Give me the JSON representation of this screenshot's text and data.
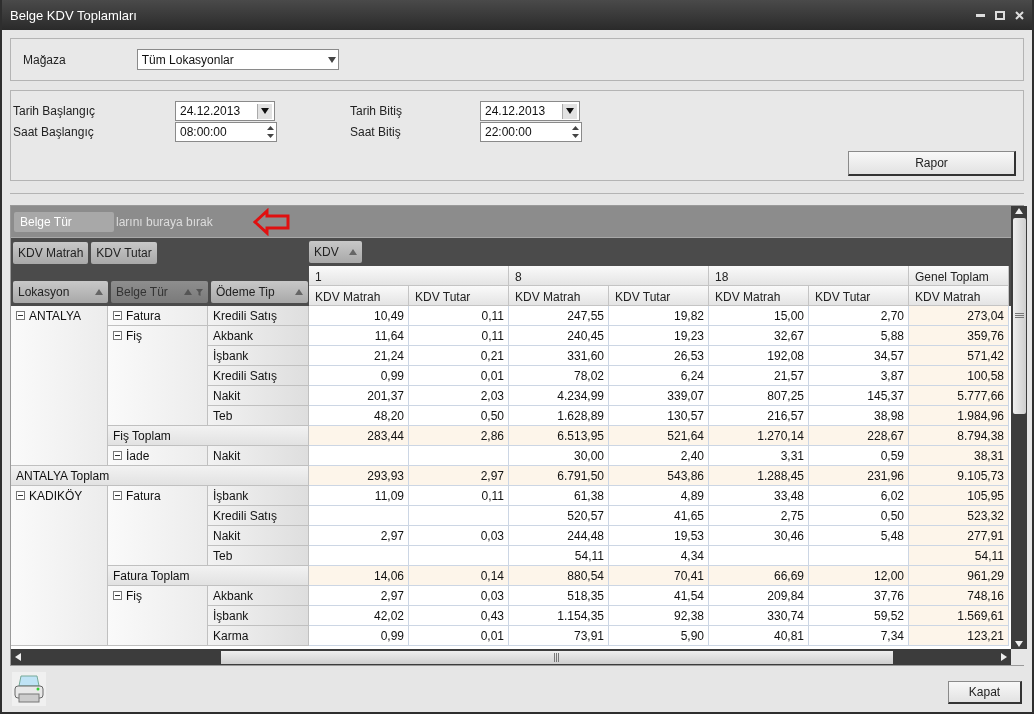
{
  "window": {
    "title": "Belge KDV Toplamları"
  },
  "store_filter": {
    "label": "Mağaza",
    "value": "Tüm Lokasyonlar"
  },
  "period": {
    "start": [
      {
        "label": "Tarih Başlangıç",
        "value": "24.12.2013",
        "kind": "date"
      },
      {
        "label": "Saat Başlangıç",
        "value": "08:00:00",
        "kind": "time"
      }
    ],
    "end": [
      {
        "label": "Tarih Bitiş",
        "value": "24.12.2013",
        "kind": "date"
      },
      {
        "label": "Saat Bitiş",
        "value": "22:00:00",
        "kind": "time"
      }
    ]
  },
  "report_button": "Rapor",
  "pivot": {
    "filter_area": {
      "dragged_field": "Belge Tür",
      "hint": "larını buraya bırak"
    },
    "data_fields": [
      "KDV Matrah",
      "KDV Tutar"
    ],
    "column_fields": [
      {
        "label": "KDV",
        "filtered": false
      }
    ],
    "row_fields": [
      {
        "label": "Lokasyon",
        "filtered": false
      },
      {
        "label": "Belge Tür",
        "filtered": true
      },
      {
        "label": "Ödeme Tip",
        "filtered": false
      }
    ],
    "column_groups": [
      {
        "label": "1",
        "measures": [
          "KDV Matrah",
          "KDV Tutar"
        ]
      },
      {
        "label": "8",
        "measures": [
          "KDV Matrah",
          "KDV Tutar"
        ]
      },
      {
        "label": "18",
        "measures": [
          "KDV Matrah",
          "KDV Tutar"
        ]
      },
      {
        "label": "Genel Toplam",
        "measures": [
          "KDV Matrah"
        ]
      }
    ],
    "locations": [
      {
        "name": "ANTALYA",
        "expanded": true,
        "doc_types": [
          {
            "name": "Fatura",
            "expanded": true,
            "payments": [
              {
                "name": "Kredili Satış",
                "values": [
                  "10,49",
                  "0,11",
                  "247,55",
                  "19,82",
                  "15,00",
                  "2,70",
                  "273,04"
                ]
              }
            ]
          },
          {
            "name": "Fiş",
            "expanded": true,
            "payments": [
              {
                "name": "Akbank",
                "values": [
                  "11,64",
                  "0,11",
                  "240,45",
                  "19,23",
                  "32,67",
                  "5,88",
                  "359,76"
                ]
              },
              {
                "name": "İşbank",
                "values": [
                  "21,24",
                  "0,21",
                  "331,60",
                  "26,53",
                  "192,08",
                  "34,57",
                  "571,42"
                ]
              },
              {
                "name": "Kredili Satış",
                "values": [
                  "0,99",
                  "0,01",
                  "78,02",
                  "6,24",
                  "21,57",
                  "3,87",
                  "100,58"
                ]
              },
              {
                "name": "Nakit",
                "values": [
                  "201,37",
                  "2,03",
                  "4.234,99",
                  "339,07",
                  "807,25",
                  "145,37",
                  "5.777,66"
                ]
              },
              {
                "name": "Teb",
                "values": [
                  "48,20",
                  "0,50",
                  "1.628,89",
                  "130,57",
                  "216,57",
                  "38,98",
                  "1.984,96"
                ]
              }
            ],
            "total": {
              "label": "Fiş Toplam",
              "values": [
                "283,44",
                "2,86",
                "6.513,95",
                "521,64",
                "1.270,14",
                "228,67",
                "8.794,38"
              ]
            }
          },
          {
            "name": "İade",
            "expanded": true,
            "payments": [
              {
                "name": "Nakit",
                "values": {
                  "2": "30,00",
                  "3": "2,40",
                  "4": "3,31",
                  "5": "0,59",
                  "6": "38,31"
                }
              }
            ]
          }
        ],
        "total": {
          "label": "ANTALYA Toplam",
          "values": [
            "293,93",
            "2,97",
            "6.791,50",
            "543,86",
            "1.288,45",
            "231,96",
            "9.105,73"
          ]
        }
      },
      {
        "name": "KADIKÖY",
        "expanded": true,
        "doc_types": [
          {
            "name": "Fatura",
            "expanded": true,
            "payments": [
              {
                "name": "İşbank",
                "values": [
                  "11,09",
                  "0,11",
                  "61,38",
                  "4,89",
                  "33,48",
                  "6,02",
                  "105,95"
                ]
              },
              {
                "name": "Kredili Satış",
                "values": {
                  "2": "520,57",
                  "3": "41,65",
                  "4": "2,75",
                  "5": "0,50",
                  "6": "523,32"
                }
              },
              {
                "name": "Nakit",
                "values": [
                  "2,97",
                  "0,03",
                  "244,48",
                  "19,53",
                  "30,46",
                  "5,48",
                  "277,91"
                ]
              },
              {
                "name": "Teb",
                "values": {
                  "2": "54,11",
                  "3": "4,34",
                  "6": "54,11"
                }
              }
            ],
            "total": {
              "label": "Fatura Toplam",
              "values": [
                "14,06",
                "0,14",
                "880,54",
                "70,41",
                "66,69",
                "12,00",
                "961,29"
              ]
            }
          },
          {
            "name": "Fiş",
            "expanded": true,
            "payments": [
              {
                "name": "Akbank",
                "values": [
                  "2,97",
                  "0,03",
                  "518,35",
                  "41,54",
                  "209,84",
                  "37,76",
                  "748,16"
                ]
              },
              {
                "name": "İşbank",
                "values": [
                  "42,02",
                  "0,43",
                  "1.154,35",
                  "92,38",
                  "330,74",
                  "59,52",
                  "1.569,61"
                ]
              },
              {
                "name": "Karma",
                "values": [
                  "0,99",
                  "0,01",
                  "73,91",
                  "5,90",
                  "40,81",
                  "7,34",
                  "123,21"
                ]
              }
            ]
          }
        ]
      }
    ]
  },
  "footer": {
    "close_button": "Kapat"
  }
}
